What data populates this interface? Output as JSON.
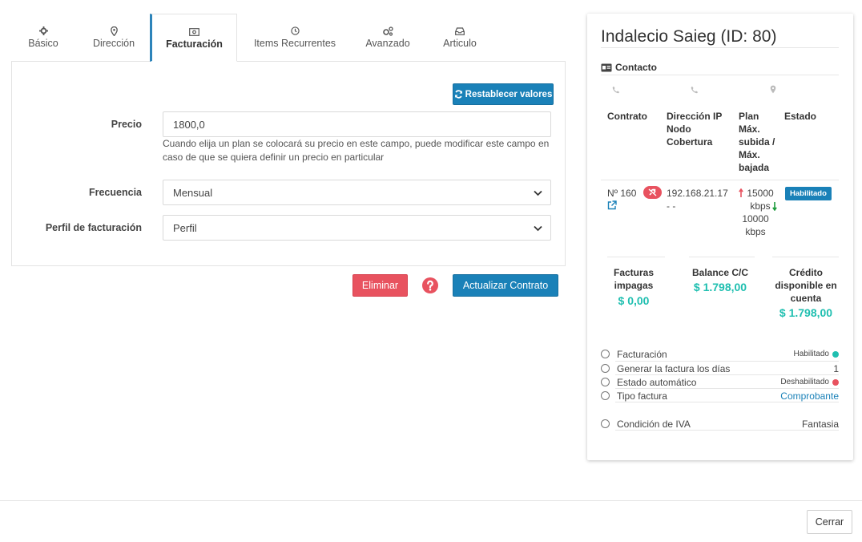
{
  "tabs": [
    {
      "label": "Básico",
      "icon": "gear-icon"
    },
    {
      "label": "Dirección",
      "icon": "map-pin-icon"
    },
    {
      "label": "Facturación",
      "icon": "money-bill-icon"
    },
    {
      "label": "Items Recurrentes",
      "icon": "clock-icon"
    },
    {
      "label": "Avanzado",
      "icon": "gears-icon"
    },
    {
      "label": "Articulo",
      "icon": "inbox-icon"
    }
  ],
  "form": {
    "reset_button": "Restablecer valores",
    "price_label": "Precio",
    "price_value": "1800,0",
    "price_help": "Cuando elija un plan se colocará su precio en este campo, puede modificar este campo en caso de que se quiera definir un precio en particular",
    "frequency_label": "Frecuencia",
    "frequency_value": "Mensual",
    "profile_label": "Perfil de facturación",
    "profile_value": "Perfil"
  },
  "actions": {
    "delete": "Eliminar",
    "update": "Actualizar Contrato",
    "close": "Cerrar"
  },
  "client": {
    "title": "Indalecio Saieg (ID: 80)",
    "contact_label": "Contacto",
    "table_headers": {
      "contract": "Contrato",
      "ip": "Dirección IP Nodo Cobertura",
      "plan": "Plan Máx. subida / Máx. bajada",
      "status": "Estado"
    },
    "row": {
      "contract": "Nº 160",
      "ip": "192.168.21.17",
      "node": "- -",
      "up": "15000 kbps",
      "down": "10000 kbps",
      "status": "Habilitado"
    },
    "stats": {
      "unpaid_label": "Facturas impagas",
      "unpaid_value": "$ 0,00",
      "balance_label": "Balance C/C",
      "balance_value": "$ 1.798,00",
      "credit_label": "Crédito disponible en cuenta",
      "credit_value": "$ 1.798,00"
    },
    "options": [
      {
        "label": "Facturación",
        "value": "Habilitado",
        "dot": "#1fbfb0"
      },
      {
        "label": "Generar la factura los días",
        "value": "1"
      },
      {
        "label": "Estado automático",
        "value": "Deshabilitado",
        "dot": "#e8525f"
      },
      {
        "label": "Tipo factura",
        "value": "Comprobante"
      }
    ],
    "iva_label": "Condición de IVA",
    "iva_value": "Fantasia"
  },
  "colors": {
    "primary": "#1a81b8",
    "danger": "#e8525f",
    "teal": "#1fbfb0"
  }
}
